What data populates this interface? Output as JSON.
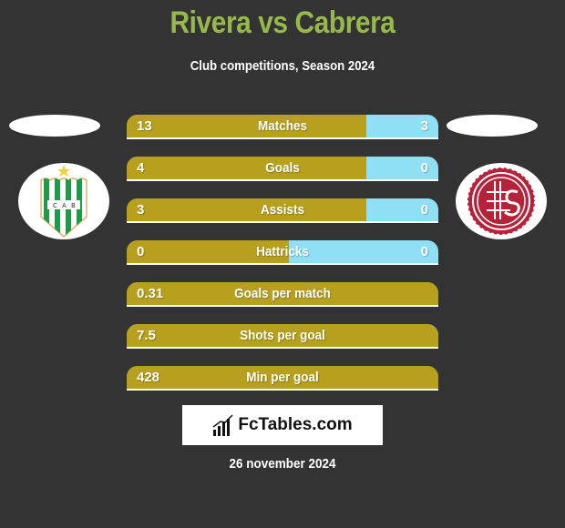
{
  "header": {
    "title": "Rivera vs Cabrera",
    "subtitle": "Club competitions, Season 2024"
  },
  "players": {
    "left": {
      "name": "Rivera",
      "club_crest": "banfield-crest-icon"
    },
    "right": {
      "name": "Cabrera",
      "club_crest": "lanus-crest-icon"
    }
  },
  "colors": {
    "title": "#97b84a",
    "left_bar": "#b7a01e",
    "right_bar": "#8fdff5",
    "background": "#333333"
  },
  "stats": [
    {
      "label": "Matches",
      "left": "13",
      "right": "3",
      "left_share": 0.77,
      "two_sided": true
    },
    {
      "label": "Goals",
      "left": "4",
      "right": "0",
      "left_share": 0.77,
      "two_sided": true
    },
    {
      "label": "Assists",
      "left": "3",
      "right": "0",
      "left_share": 0.77,
      "two_sided": true
    },
    {
      "label": "Hattricks",
      "left": "0",
      "right": "0",
      "left_share": 0.52,
      "two_sided": true
    },
    {
      "label": "Goals per match",
      "left": "0.31",
      "right": "",
      "left_share": 1.0,
      "two_sided": false
    },
    {
      "label": "Shots per goal",
      "left": "7.5",
      "right": "",
      "left_share": 1.0,
      "two_sided": false
    },
    {
      "label": "Min per goal",
      "left": "428",
      "right": "",
      "left_share": 1.0,
      "two_sided": false
    }
  ],
  "footer": {
    "brand": "FcTables.com",
    "date": "26 november 2024"
  }
}
